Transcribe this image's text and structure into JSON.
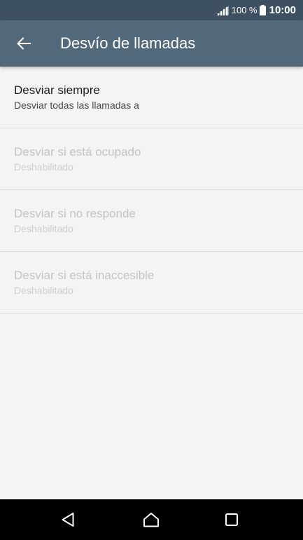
{
  "status_bar": {
    "battery_percent": "100 %",
    "time": "10:00",
    "signal_icon": "signal-icon",
    "battery_icon": "battery-icon"
  },
  "app_bar": {
    "back_icon": "arrow-back-icon",
    "title": "Desvío de llamadas"
  },
  "list": {
    "items": [
      {
        "title": "Desviar siempre",
        "subtitle": "Desviar todas las llamadas a",
        "enabled": true
      },
      {
        "title": "Desviar si está ocupado",
        "subtitle": "Deshabilitado",
        "enabled": false
      },
      {
        "title": "Desviar si no responde",
        "subtitle": "Deshabilitado",
        "enabled": false
      },
      {
        "title": "Desviar si está inaccesible",
        "subtitle": "Deshabilitado",
        "enabled": false
      }
    ]
  },
  "nav_bar": {
    "back_icon": "triangle-back-icon",
    "home_icon": "home-icon",
    "recents_icon": "recents-icon"
  },
  "colors": {
    "status_bar": "#3e5162",
    "app_bar": "#52687b",
    "background": "#f4f4f4",
    "nav_bar": "#000000"
  }
}
